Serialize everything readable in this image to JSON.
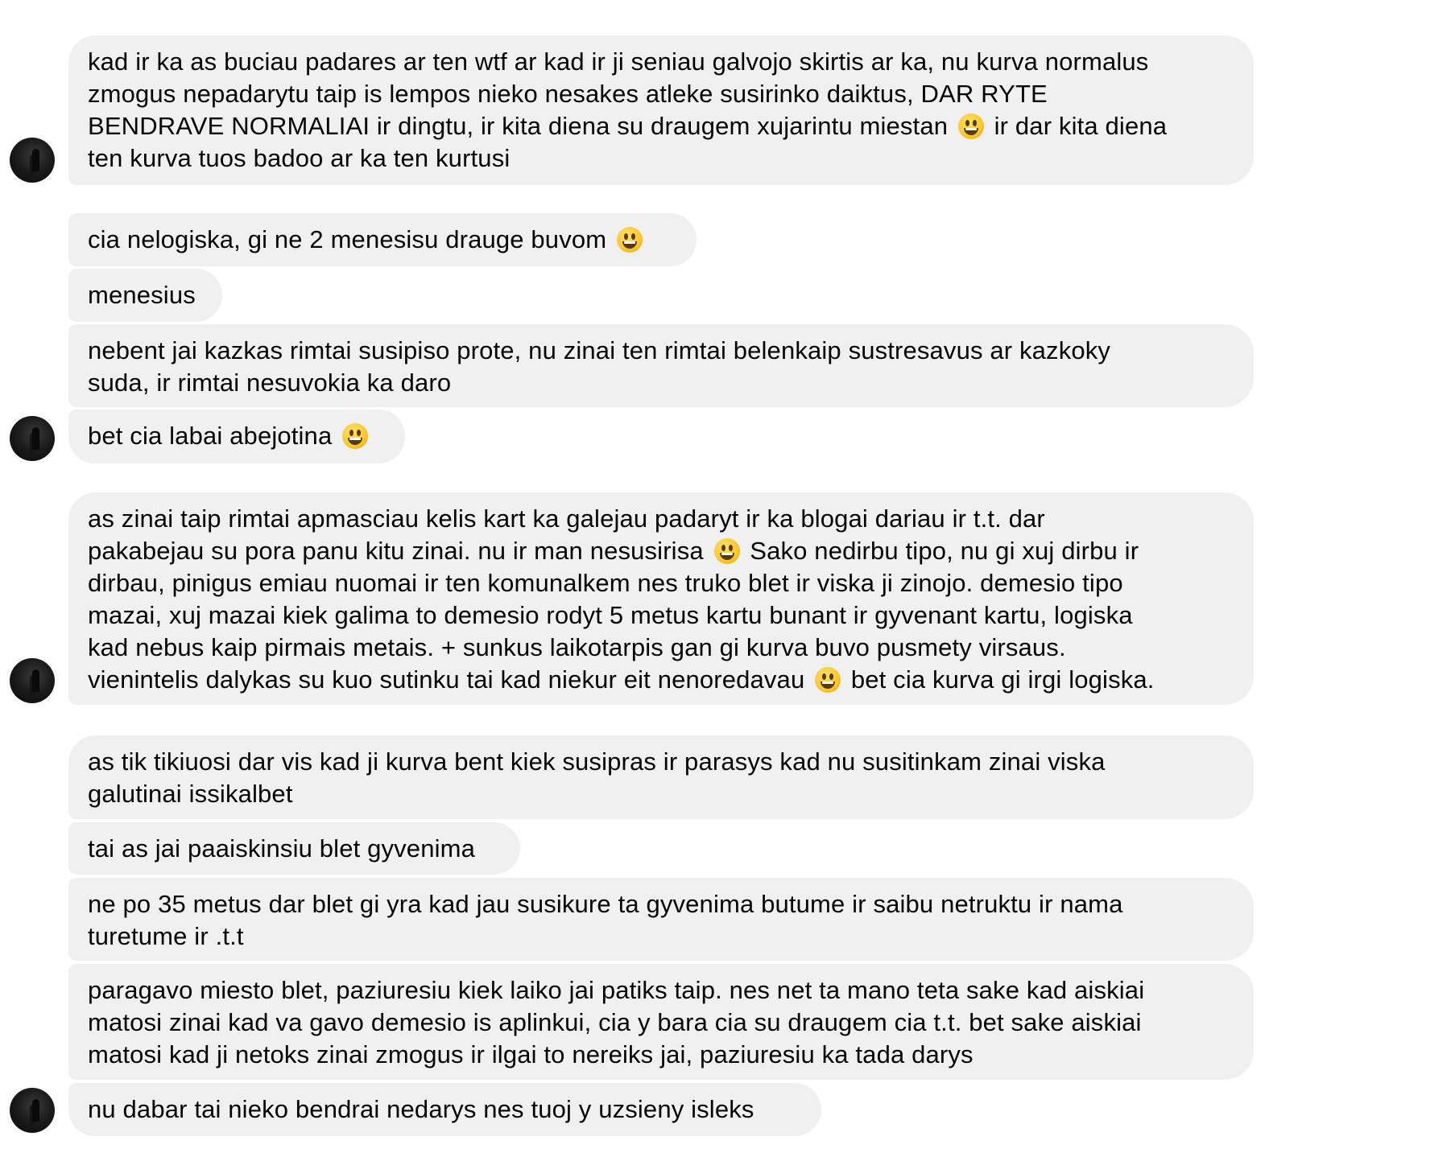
{
  "messages": [
    {
      "lines": [
        "kad ir ka as buciau padares ar ten wtf ar kad ir ji seniau galvojo skirtis ar ka, nu kurva normalus",
        "zmogus nepadarytu taip is lempos nieko nesakes atleke susirinko daiktus, DAR RYTE",
        [
          "BENDRAVE NORMALIAI ir dingtu, ir kita diena su draugem xujarintu miestan ",
          "grinning-face-emoji",
          " ir dar kita diena"
        ],
        "ten kurva tuos badoo ar ka ten kurtusi"
      ]
    },
    {
      "lines": [
        [
          "cia nelogiska, gi ne 2 menesisu drauge buvom ",
          "grinning-face-emoji"
        ]
      ]
    },
    {
      "lines": [
        "menesius"
      ]
    },
    {
      "lines": [
        "nebent jai kazkas rimtai susipiso prote, nu zinai ten rimtai belenkaip sustresavus ar kazkoky",
        "suda, ir rimtai nesuvokia ka daro"
      ]
    },
    {
      "lines": [
        [
          "bet cia labai abejotina ",
          "grinning-face-emoji"
        ]
      ]
    },
    {
      "lines": [
        "as zinai taip rimtai apmasciau kelis kart ka galejau padaryt ir ka blogai dariau ir t.t. dar",
        [
          "pakabejau su pora panu kitu zinai. nu ir man nesusirisa ",
          "grinning-face-emoji",
          " Sako nedirbu tipo, nu gi xuj dirbu ir"
        ],
        "dirbau, pinigus emiau nuomai ir ten komunalkem nes truko blet ir viska ji zinojo. demesio tipo",
        "mazai, xuj mazai kiek galima to demesio rodyt 5 metus kartu bunant ir gyvenant kartu, logiska",
        "kad nebus kaip pirmais metais. + sunkus laikotarpis gan gi kurva buvo pusmety virsaus.",
        [
          "vienintelis dalykas su kuo sutinku tai kad niekur eit nenoredavau ",
          "grinning-face-emoji",
          " bet cia kurva gi irgi logiska."
        ]
      ]
    },
    {
      "lines": [
        "as tik tikiuosi dar vis kad ji kurva bent kiek susipras ir parasys kad nu susitinkam zinai viska",
        "galutinai issikalbet"
      ]
    },
    {
      "lines": [
        "tai as jai paaiskinsiu blet gyvenima"
      ]
    },
    {
      "lines": [
        "ne po 35 metus dar blet gi yra kad jau susikure ta gyvenima butume ir saibu netruktu ir nama",
        "turetume ir .t.t"
      ]
    },
    {
      "lines": [
        "paragavo miesto blet, paziuresiu kiek laiko jai patiks taip. nes net ta mano teta sake kad aiskiai",
        "matosi zinai kad va gavo demesio is aplinkui, cia y bara cia su draugem cia t.t. bet sake aiskiai",
        "matosi kad ji netoks zinai zmogus ir ilgai to nereiks jai, paziuresiu ka tada darys"
      ]
    },
    {
      "lines": [
        "nu dabar tai nieko bendrai nedarys nes tuoj y uzsieny isleks"
      ]
    }
  ]
}
